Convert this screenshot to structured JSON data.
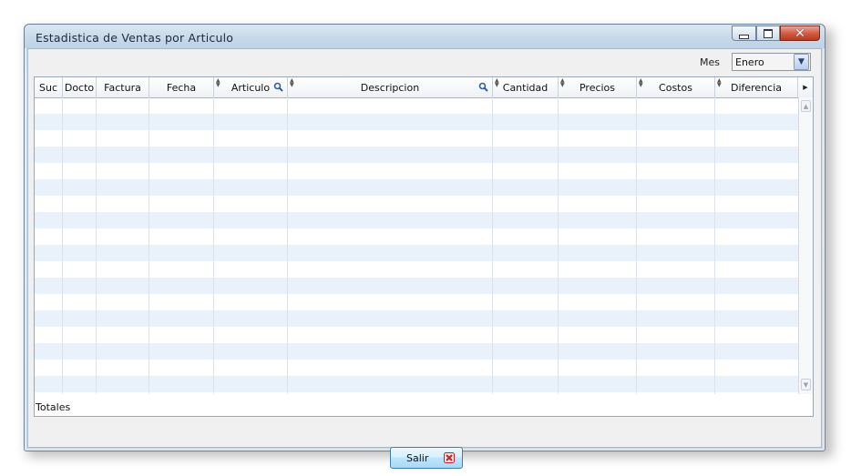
{
  "window": {
    "title": "Estadistica de Ventas por Articulo",
    "controls": {
      "minimize": "minimize",
      "maximize": "maximize",
      "close": "close"
    }
  },
  "filter": {
    "mes_label": "Mes",
    "mes_value": "Enero"
  },
  "table": {
    "columns": [
      {
        "label": "Suc"
      },
      {
        "label": "Docto"
      },
      {
        "label": "Factura"
      },
      {
        "label": "Fecha"
      },
      {
        "label": "Articulo",
        "sortable": true,
        "search_icon": true
      },
      {
        "label": "Descripcion",
        "sortable": true,
        "search_icon": true
      },
      {
        "label": "Cantidad",
        "sortable": true
      },
      {
        "label": "Precios",
        "sortable": true
      },
      {
        "label": "Costos",
        "sortable": true
      },
      {
        "label": "Diferencia",
        "sortable": true
      }
    ],
    "rows": [],
    "footer_label": "Totales"
  },
  "actions": {
    "salir_label": "Salir",
    "salir_icon": "close-x-icon"
  },
  "colors": {
    "row_alt": "#e9f1fb",
    "button_border": "#3c7fb1",
    "close_button": "#c8472f",
    "salir_icon": "#c8202b"
  }
}
